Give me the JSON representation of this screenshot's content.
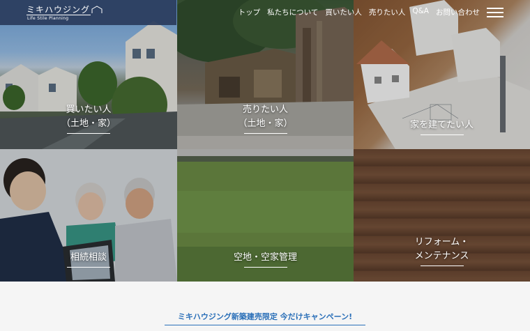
{
  "header": {
    "logo_main": "ミキハウジング",
    "logo_sub": "Life Stile Planning",
    "nav": [
      {
        "label": "トップ"
      },
      {
        "label": "私たちについて"
      },
      {
        "label": "買いたい人"
      },
      {
        "label": "売りたい人"
      },
      {
        "label": "Q&A"
      },
      {
        "label": "お問い合わせ"
      }
    ]
  },
  "tiles": {
    "buy": {
      "line1": "買いたい人",
      "line2": "（土地・家）"
    },
    "sell": {
      "line1": "売りたい人",
      "line2": "（土地・家）"
    },
    "build": {
      "line1": "家を建てたい人"
    },
    "inherit": {
      "line1": "相続相談"
    },
    "vacant": {
      "line1": "空地・空家管理"
    },
    "reform": {
      "line1": "リフォーム・",
      "line2": "メンテナンス"
    }
  },
  "campaign": {
    "text": "ミキハウジング新築建売限定 今だけキャンペーン!"
  },
  "colors": {
    "header_band": "#2a3c5c",
    "accent": "#2a6fb8"
  }
}
